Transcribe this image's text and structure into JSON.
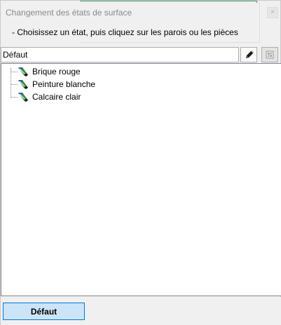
{
  "window": {
    "title": "Changement des états de surface",
    "close_label": "×"
  },
  "instruction": "- Choisissez un état, puis cliquez sur les parois ou les pièces",
  "combo": {
    "selected": "Défaut"
  },
  "toolbar": {
    "edit_icon": "pencil-icon",
    "grid_icon": "grid-icon"
  },
  "tree": {
    "items": [
      {
        "label": "Brique rouge",
        "icon": "texture-brush-icon"
      },
      {
        "label": "Peinture blanche",
        "icon": "texture-brush-icon"
      },
      {
        "label": "Calcaire clair",
        "icon": "texture-brush-icon"
      }
    ]
  },
  "footer": {
    "default_button": "Défaut"
  },
  "colors": {
    "accent": "#0078d7",
    "button_bg": "#cce4f7",
    "title_text": "#8a8a8a"
  }
}
